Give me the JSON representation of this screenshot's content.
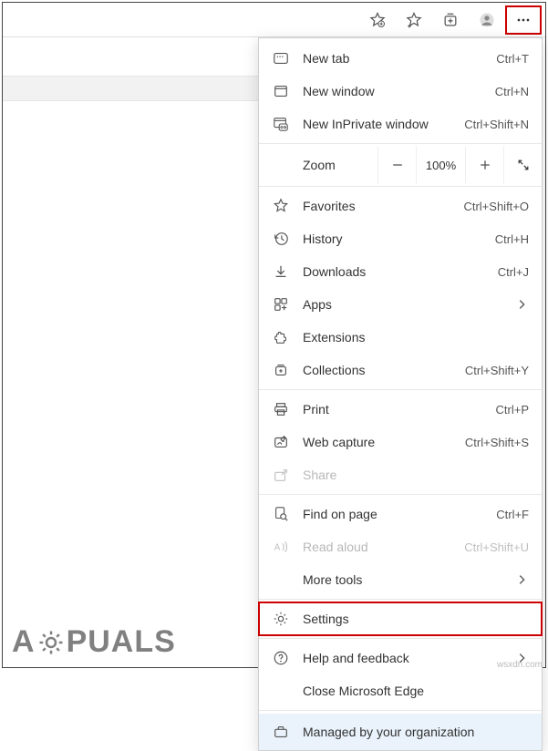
{
  "toolbar": {
    "icons": [
      "favorite-this-icon",
      "favorites-icon",
      "collections-icon",
      "profile-icon",
      "more-icon"
    ]
  },
  "zoom": {
    "label": "Zoom",
    "value": "100%"
  },
  "menu": {
    "new_tab": {
      "label": "New tab",
      "shortcut": "Ctrl+T"
    },
    "new_window": {
      "label": "New window",
      "shortcut": "Ctrl+N"
    },
    "new_inprivate": {
      "label": "New InPrivate window",
      "shortcut": "Ctrl+Shift+N"
    },
    "favorites": {
      "label": "Favorites",
      "shortcut": "Ctrl+Shift+O"
    },
    "history": {
      "label": "History",
      "shortcut": "Ctrl+H"
    },
    "downloads": {
      "label": "Downloads",
      "shortcut": "Ctrl+J"
    },
    "apps": {
      "label": "Apps"
    },
    "extensions": {
      "label": "Extensions"
    },
    "collections": {
      "label": "Collections",
      "shortcut": "Ctrl+Shift+Y"
    },
    "print": {
      "label": "Print",
      "shortcut": "Ctrl+P"
    },
    "web_capture": {
      "label": "Web capture",
      "shortcut": "Ctrl+Shift+S"
    },
    "share": {
      "label": "Share"
    },
    "find": {
      "label": "Find on page",
      "shortcut": "Ctrl+F"
    },
    "read_aloud": {
      "label": "Read aloud",
      "shortcut": "Ctrl+Shift+U"
    },
    "more_tools": {
      "label": "More tools"
    },
    "settings": {
      "label": "Settings"
    },
    "help": {
      "label": "Help and feedback"
    },
    "close": {
      "label": "Close Microsoft Edge"
    },
    "managed": {
      "label": "Managed by your organization"
    }
  },
  "watermark": {
    "pre": "A",
    "post": "PUALS"
  },
  "source": "wsxdn.com"
}
